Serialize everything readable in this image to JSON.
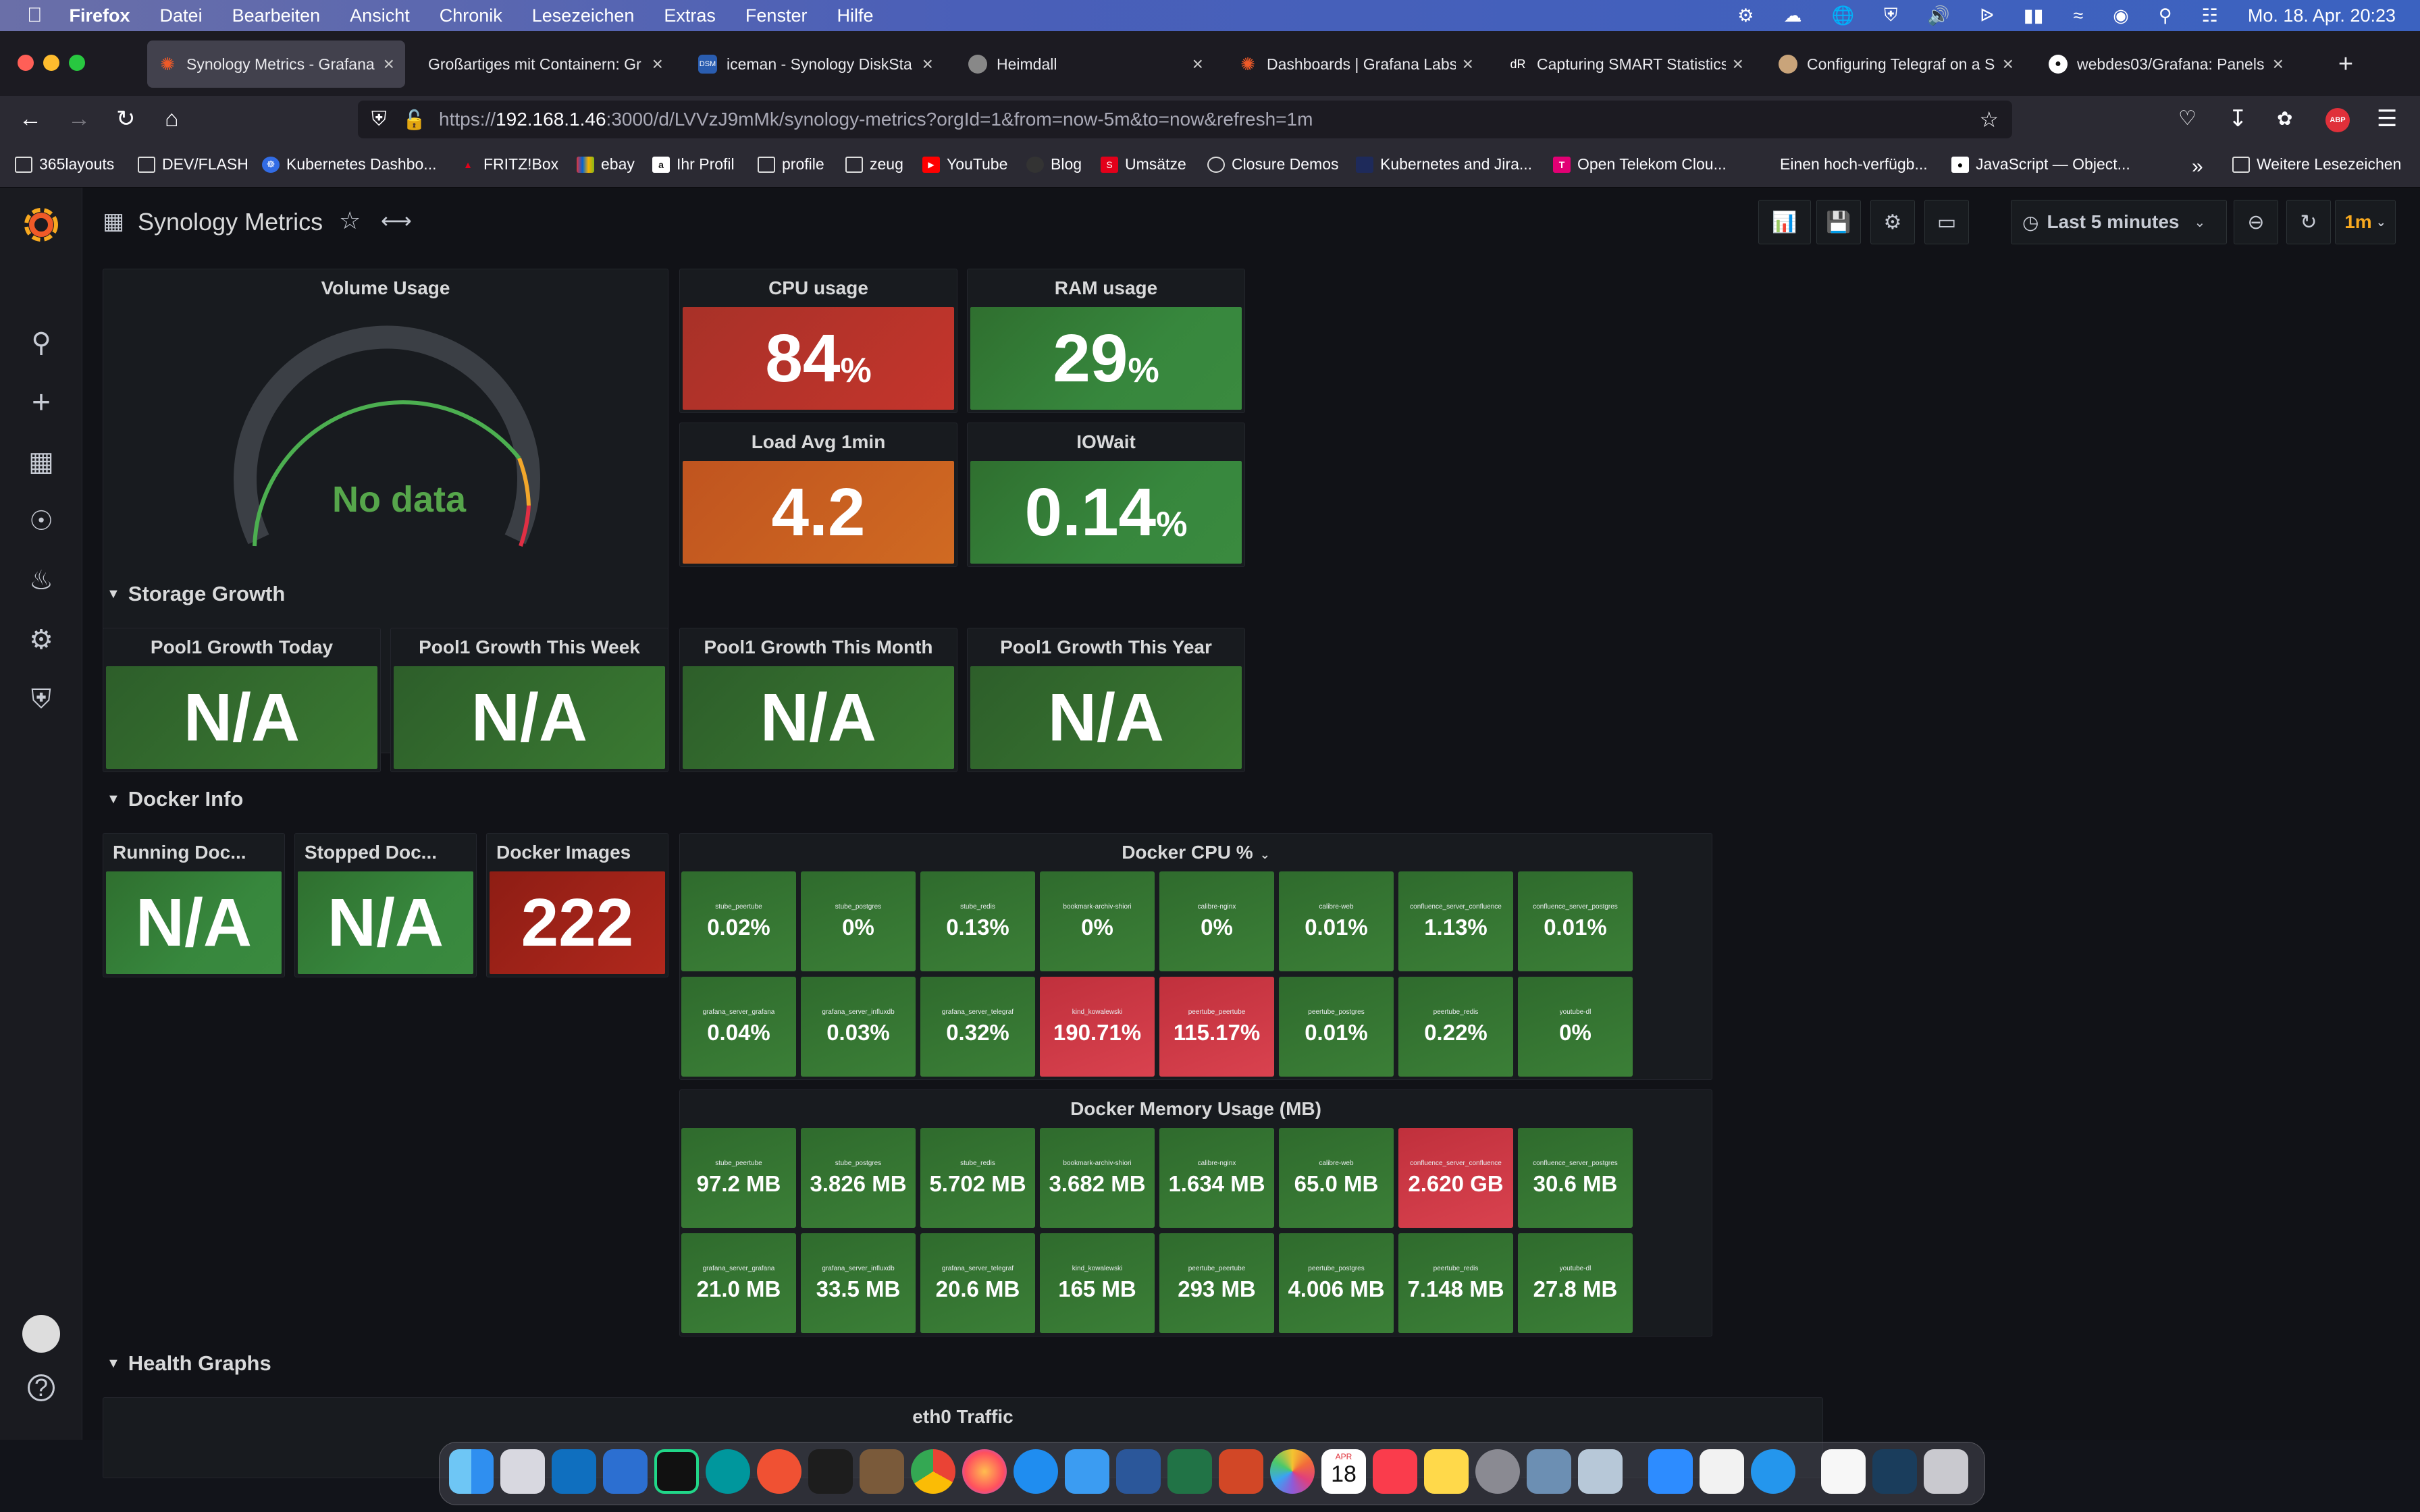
{
  "menubar": {
    "app": "Firefox",
    "items": [
      "Datei",
      "Bearbeiten",
      "Ansicht",
      "Chronik",
      "Lesezeichen",
      "Extras",
      "Fenster",
      "Hilfe"
    ],
    "clock": "Mo. 18. Apr.  20:23"
  },
  "tabs": [
    {
      "title": "Synology Metrics - Grafana",
      "active": true
    },
    {
      "title": "Großartiges mit Containern: Gr"
    },
    {
      "title": "iceman - Synology DiskSta"
    },
    {
      "title": "Heimdall"
    },
    {
      "title": "Dashboards | Grafana Labs"
    },
    {
      "title": "Capturing SMART Statistics"
    },
    {
      "title": "Configuring Telegraf on a S"
    },
    {
      "title": "webdes03/Grafana: Panels"
    }
  ],
  "url": {
    "prefix": "https://",
    "host": "192.168.1.46",
    "rest": ":3000/d/LVVzJ9mMk/synology-metrics?orgId=1&from=now-5m&to=now&refresh=1m"
  },
  "bookmarks": [
    "365layouts",
    "DEV/FLASH",
    "Kubernetes Dashbo...",
    "FRITZ!Box",
    "ebay",
    "Ihr Profil",
    "profile",
    "zeug",
    "YouTube",
    "Blog",
    "Umsätze",
    "Closure Demos",
    "Kubernetes and Jira...",
    "Open Telekom Clou...",
    "Einen hoch-verfügb...",
    "JavaScript — Object...",
    "Weitere Lesezeichen"
  ],
  "dashboard": {
    "title": "Synology Metrics",
    "time_range": "Last 5 minutes",
    "refresh": "1m",
    "volume": {
      "title": "Volume Usage",
      "value": "No data"
    },
    "cpu": {
      "title": "CPU usage",
      "value": "84",
      "unit": "%"
    },
    "ram": {
      "title": "RAM usage",
      "value": "29",
      "unit": "%"
    },
    "load": {
      "title": "Load Avg 1min",
      "value": "4.2"
    },
    "iowait": {
      "title": "IOWait",
      "value": "0.14",
      "unit": "%"
    },
    "rows": {
      "storage": "Storage Growth",
      "docker": "Docker Info",
      "health": "Health Graphs"
    },
    "growth": [
      {
        "title": "Pool1 Growth Today",
        "value": "N/A"
      },
      {
        "title": "Pool1 Growth This Week",
        "value": "N/A"
      },
      {
        "title": "Pool1 Growth This Month",
        "value": "N/A"
      },
      {
        "title": "Pool1 Growth This Year",
        "value": "N/A"
      }
    ],
    "docker_stats": [
      {
        "title": "Running Doc...",
        "value": "N/A"
      },
      {
        "title": "Stopped Doc...",
        "value": "N/A"
      },
      {
        "title": "Docker Images",
        "value": "222"
      }
    ],
    "docker_cpu_title": "Docker CPU %",
    "docker_cpu": [
      {
        "name": "stube_peertube",
        "value": "0.02%",
        "alert": false
      },
      {
        "name": "stube_postgres",
        "value": "0%",
        "alert": false
      },
      {
        "name": "stube_redis",
        "value": "0.13%",
        "alert": false
      },
      {
        "name": "bookmark-archiv-shiori",
        "value": "0%",
        "alert": false
      },
      {
        "name": "calibre-nginx",
        "value": "0%",
        "alert": false
      },
      {
        "name": "calibre-web",
        "value": "0.01%",
        "alert": false
      },
      {
        "name": "confluence_server_confluence",
        "value": "1.13%",
        "alert": false
      },
      {
        "name": "confluence_server_postgres",
        "value": "0.01%",
        "alert": false
      },
      {
        "name": "grafana_server_grafana",
        "value": "0.04%",
        "alert": false
      },
      {
        "name": "grafana_server_influxdb",
        "value": "0.03%",
        "alert": false
      },
      {
        "name": "grafana_server_telegraf",
        "value": "0.32%",
        "alert": false
      },
      {
        "name": "kind_kowalewski",
        "value": "190.71%",
        "alert": true
      },
      {
        "name": "peertube_peertube",
        "value": "115.17%",
        "alert": true
      },
      {
        "name": "peertube_postgres",
        "value": "0.01%",
        "alert": false
      },
      {
        "name": "peertube_redis",
        "value": "0.22%",
        "alert": false
      },
      {
        "name": "youtube-dl",
        "value": "0%",
        "alert": false
      }
    ],
    "docker_mem_title": "Docker Memory Usage (MB)",
    "docker_mem": [
      {
        "name": "stube_peertube",
        "value": "97.2 MB",
        "alert": false
      },
      {
        "name": "stube_postgres",
        "value": "3.826 MB",
        "alert": false
      },
      {
        "name": "stube_redis",
        "value": "5.702 MB",
        "alert": false
      },
      {
        "name": "bookmark-archiv-shiori",
        "value": "3.682 MB",
        "alert": false
      },
      {
        "name": "calibre-nginx",
        "value": "1.634 MB",
        "alert": false
      },
      {
        "name": "calibre-web",
        "value": "65.0 MB",
        "alert": false
      },
      {
        "name": "confluence_server_confluence",
        "value": "2.620 GB",
        "alert": true
      },
      {
        "name": "confluence_server_postgres",
        "value": "30.6 MB",
        "alert": false
      },
      {
        "name": "grafana_server_grafana",
        "value": "21.0 MB",
        "alert": false
      },
      {
        "name": "grafana_server_influxdb",
        "value": "33.5 MB",
        "alert": false
      },
      {
        "name": "grafana_server_telegraf",
        "value": "20.6 MB",
        "alert": false
      },
      {
        "name": "kind_kowalewski",
        "value": "165 MB",
        "alert": false
      },
      {
        "name": "peertube_peertube",
        "value": "293 MB",
        "alert": false
      },
      {
        "name": "peertube_postgres",
        "value": "4.006 MB",
        "alert": false
      },
      {
        "name": "peertube_redis",
        "value": "7.148 MB",
        "alert": false
      },
      {
        "name": "youtube-dl",
        "value": "27.8 MB",
        "alert": false
      }
    ],
    "eth0_title": "eth0 Traffic"
  },
  "colors": {
    "green": "#37873d",
    "red": "#c4352c",
    "orange": "#d06a22",
    "alert": "#d9424f",
    "grafana_orange": "#f05a28"
  },
  "dock_calendar": {
    "month": "APR",
    "day": "18"
  }
}
